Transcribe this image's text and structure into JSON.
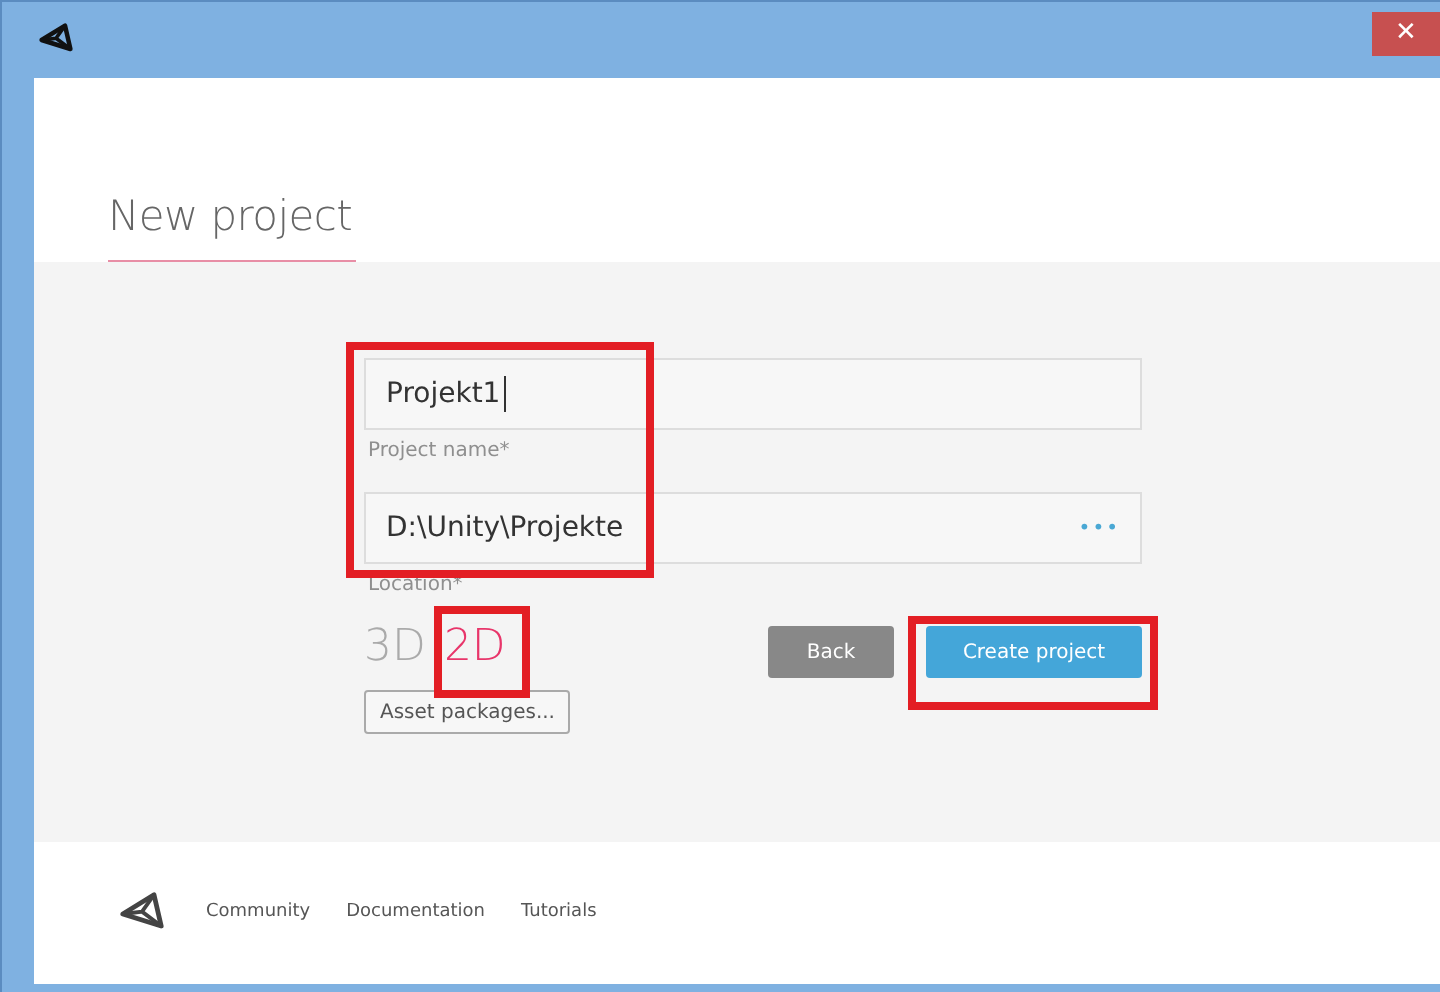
{
  "window": {
    "close": "✕"
  },
  "title": "New project",
  "fields": [
    {
      "value": "Projekt1",
      "label": "Project name*",
      "focused": true
    },
    {
      "value": "D:\\Unity\\Projekte",
      "label": "Location*",
      "browse": "•••"
    }
  ],
  "modes": [
    {
      "label": "3D",
      "selected": false
    },
    {
      "label": "2D",
      "selected": true
    }
  ],
  "asset_button": "Asset packages...",
  "buttons": [
    {
      "label": "Back",
      "kind": "secondary"
    },
    {
      "label": "Create project",
      "kind": "primary"
    }
  ],
  "footer_links": [
    "Community",
    "Documentation",
    "Tutorials"
  ]
}
